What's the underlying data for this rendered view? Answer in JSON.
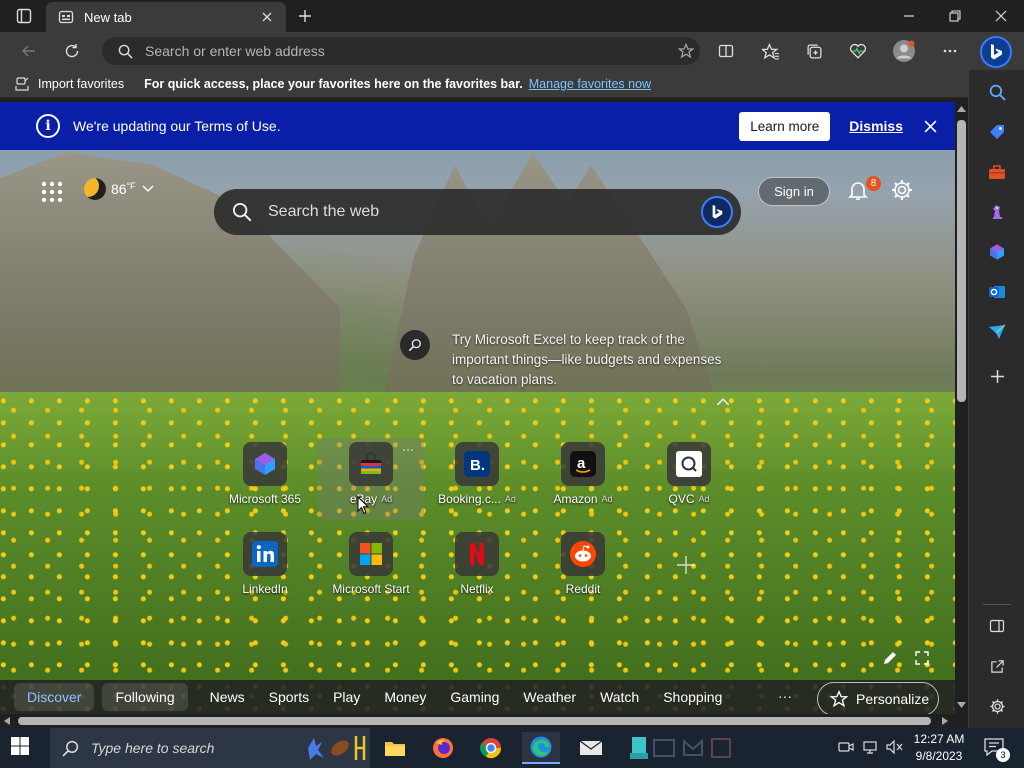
{
  "browser": {
    "tab_title": "New tab",
    "address_placeholder": "Search or enter web address"
  },
  "favorites_bar": {
    "import_label": "Import favorites",
    "message": "For quick access, place your favorites here on the favorites bar.",
    "manage_link": "Manage favorites now"
  },
  "banner": {
    "message": "We're updating our Terms of Use.",
    "learn_more": "Learn more",
    "dismiss": "Dismiss"
  },
  "weather": {
    "temp": "86",
    "unit": "°F"
  },
  "web_search": {
    "placeholder": "Search the web"
  },
  "header": {
    "sign_in": "Sign in",
    "notification_count": "8"
  },
  "tip": {
    "text": "Try Microsoft Excel to keep track of the important things—like budgets and expenses to vacation plans."
  },
  "quick_links": {
    "ad_label": "Ad",
    "tiles": [
      {
        "label": "Microsoft 365",
        "ad": false
      },
      {
        "label": "eBay",
        "ad": true
      },
      {
        "label": "Booking.c...",
        "ad": true
      },
      {
        "label": "Amazon",
        "ad": true
      },
      {
        "label": "QVC",
        "ad": true
      },
      {
        "label": "LinkedIn",
        "ad": false
      },
      {
        "label": "Microsoft Start",
        "ad": false
      },
      {
        "label": "Netflix",
        "ad": false
      },
      {
        "label": "Reddit",
        "ad": false
      }
    ],
    "more_glyph": "···"
  },
  "feed_nav": {
    "discover": "Discover",
    "following": "Following",
    "categories": [
      "News",
      "Sports",
      "Play",
      "Money",
      "Gaming",
      "Weather",
      "Watch",
      "Shopping"
    ],
    "more": "···",
    "personalize": "Personalize"
  },
  "taskbar": {
    "search_placeholder": "Type here to search",
    "time": "12:27 AM",
    "date": "9/8/2023",
    "notification_count": "3"
  },
  "colors": {
    "banner_bg": "#0a1fa8",
    "link": "#7cc3ff",
    "accent": "#3c7dff",
    "badge": "#e5521c"
  }
}
